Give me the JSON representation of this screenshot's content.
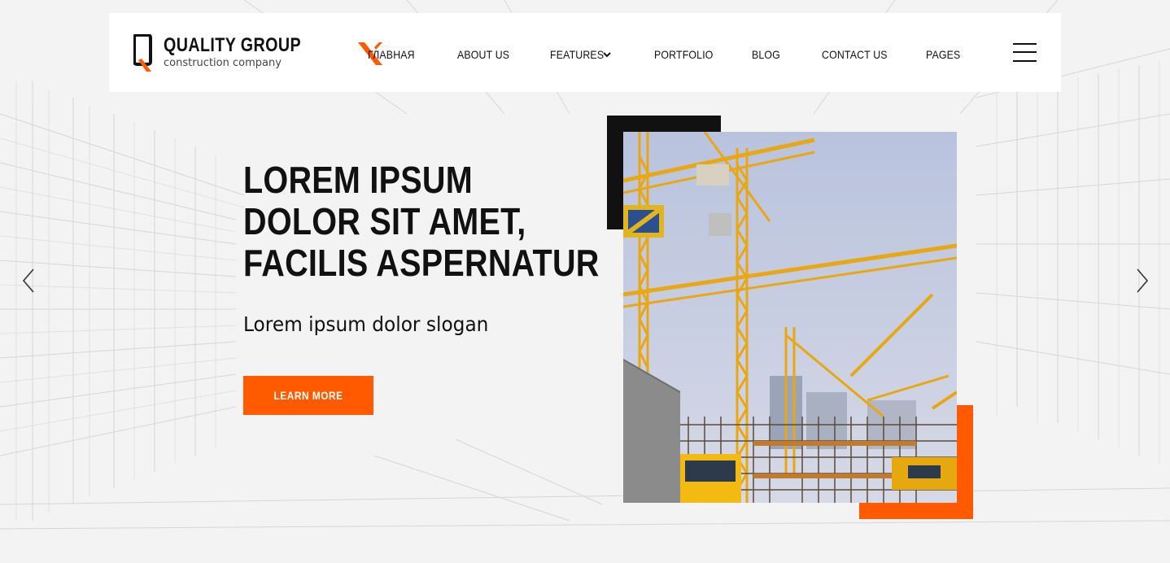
{
  "logo": {
    "title": "QUALITY GROUP",
    "subtitle": "construction company",
    "mark_letter": "Q"
  },
  "nav": {
    "items": [
      {
        "label": "ГЛАВНАЯ",
        "active": true
      },
      {
        "label": "ABOUT US"
      },
      {
        "label": "FEATURES",
        "has_dropdown": true
      },
      {
        "label": "PORTFOLIO"
      },
      {
        "label": "BLOG"
      },
      {
        "label": "CONTACT US"
      },
      {
        "label": "PAGES"
      }
    ],
    "menu_icon": "hamburger-menu-icon"
  },
  "hero": {
    "title_lines": [
      "LOREM IPSUM",
      "DOLOR SIT AMET,",
      "FACILIS ASPERNATUR"
    ],
    "slogan": "Lorem ipsum dolor slogan",
    "button_label": "LEARN MORE"
  },
  "slider": {
    "prev_icon": "chevron-left-icon",
    "next_icon": "chevron-right-icon"
  },
  "colors": {
    "accent": "#ff5a00",
    "dark": "#111111",
    "sky": "#c9cfe0",
    "crane": "#f0b21c"
  }
}
